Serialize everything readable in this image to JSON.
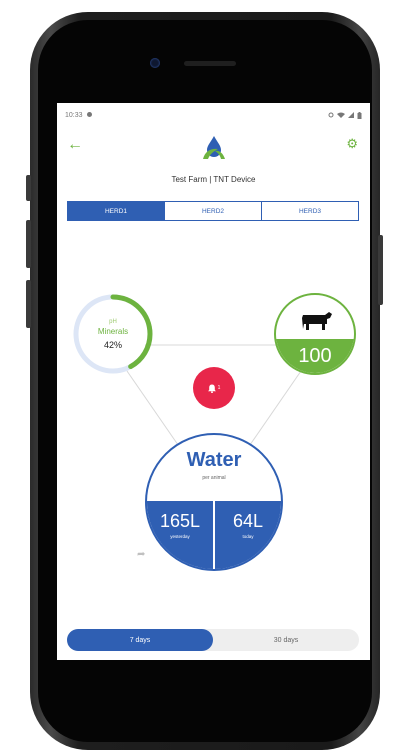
{
  "status_bar": {
    "time": "10:33"
  },
  "header": {
    "subtitle": "Test Farm | TNT Device"
  },
  "tabs": [
    {
      "label": "HERD1",
      "active": true
    },
    {
      "label": "HERD2",
      "active": false
    },
    {
      "label": "HERD3",
      "active": false
    }
  ],
  "minerals": {
    "small_text": "pH",
    "label": "Minerals",
    "percent_text": "42%",
    "percent": 42
  },
  "herd": {
    "count": "100"
  },
  "alert": {
    "count": "1"
  },
  "water": {
    "title": "Water",
    "subtitle": "per animal",
    "yesterday_value": "165L",
    "yesterday_label": "yesterday",
    "today_value": "64L",
    "today_label": "today"
  },
  "period_toggle": [
    {
      "label": "7 days",
      "active": true
    },
    {
      "label": "30 days",
      "active": false
    }
  ],
  "colors": {
    "primary_blue": "#2f5fb3",
    "accent_green": "#6db33f",
    "alert_red": "#e8264a"
  },
  "icons": {
    "back": "arrow-left-icon",
    "settings": "gear-icon",
    "logo": "water-drop-leaf-logo",
    "cow": "cow-icon",
    "bell": "bell-icon",
    "share": "share-icon"
  }
}
